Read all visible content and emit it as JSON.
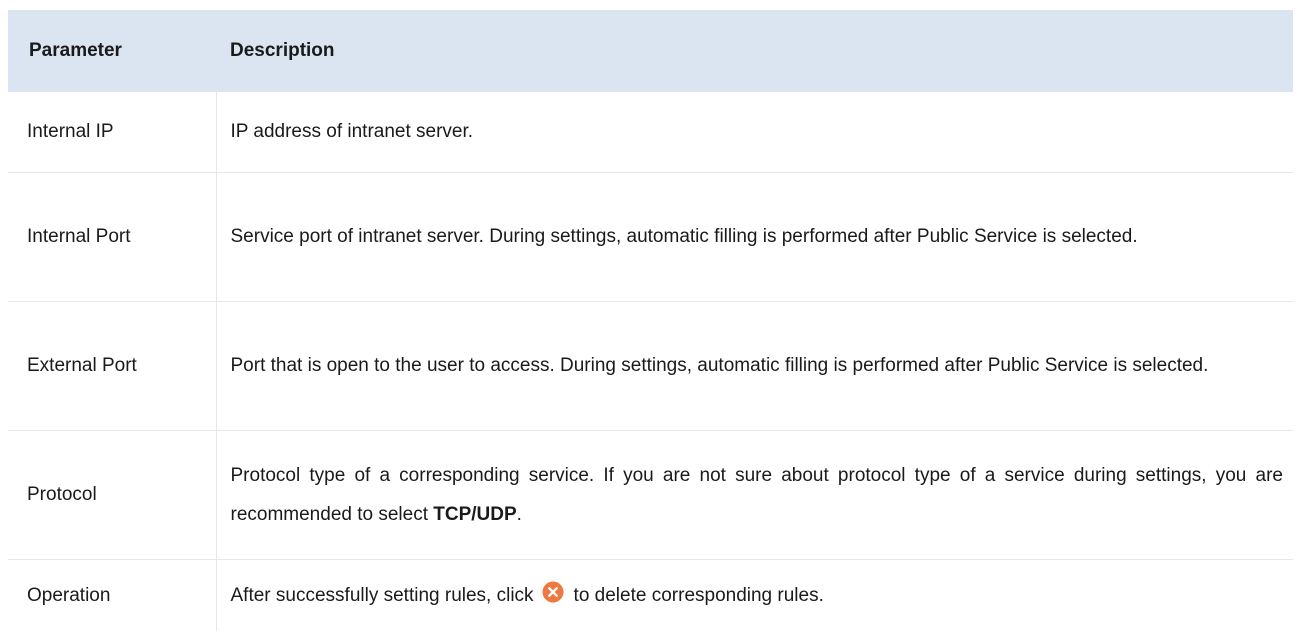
{
  "table": {
    "headers": [
      "Parameter",
      "Description"
    ],
    "rows": [
      {
        "name": "Internal IP",
        "desc": "IP address of intranet server."
      },
      {
        "name": "Internal Port",
        "desc": "Service port of intranet server. During settings, automatic filling is performed after Public Service is selected."
      },
      {
        "name": "External Port",
        "desc": "Port that is open to the user to access. During settings, automatic filling is performed after Public Service is selected."
      },
      {
        "name": "Protocol",
        "desc_before": "Protocol type of a corresponding service. If you are not sure about protocol type of a service during settings, you are recommended to select ",
        "desc_bold": "TCP/UDP",
        "desc_after": "."
      },
      {
        "name": "Operation",
        "desc_before": "After successfully setting rules, click",
        "desc_icon": "delete-icon",
        "desc_after": "to delete corresponding rules."
      }
    ]
  },
  "colors": {
    "header_background": "#dbe5f1",
    "delete_icon": "#f07840"
  }
}
